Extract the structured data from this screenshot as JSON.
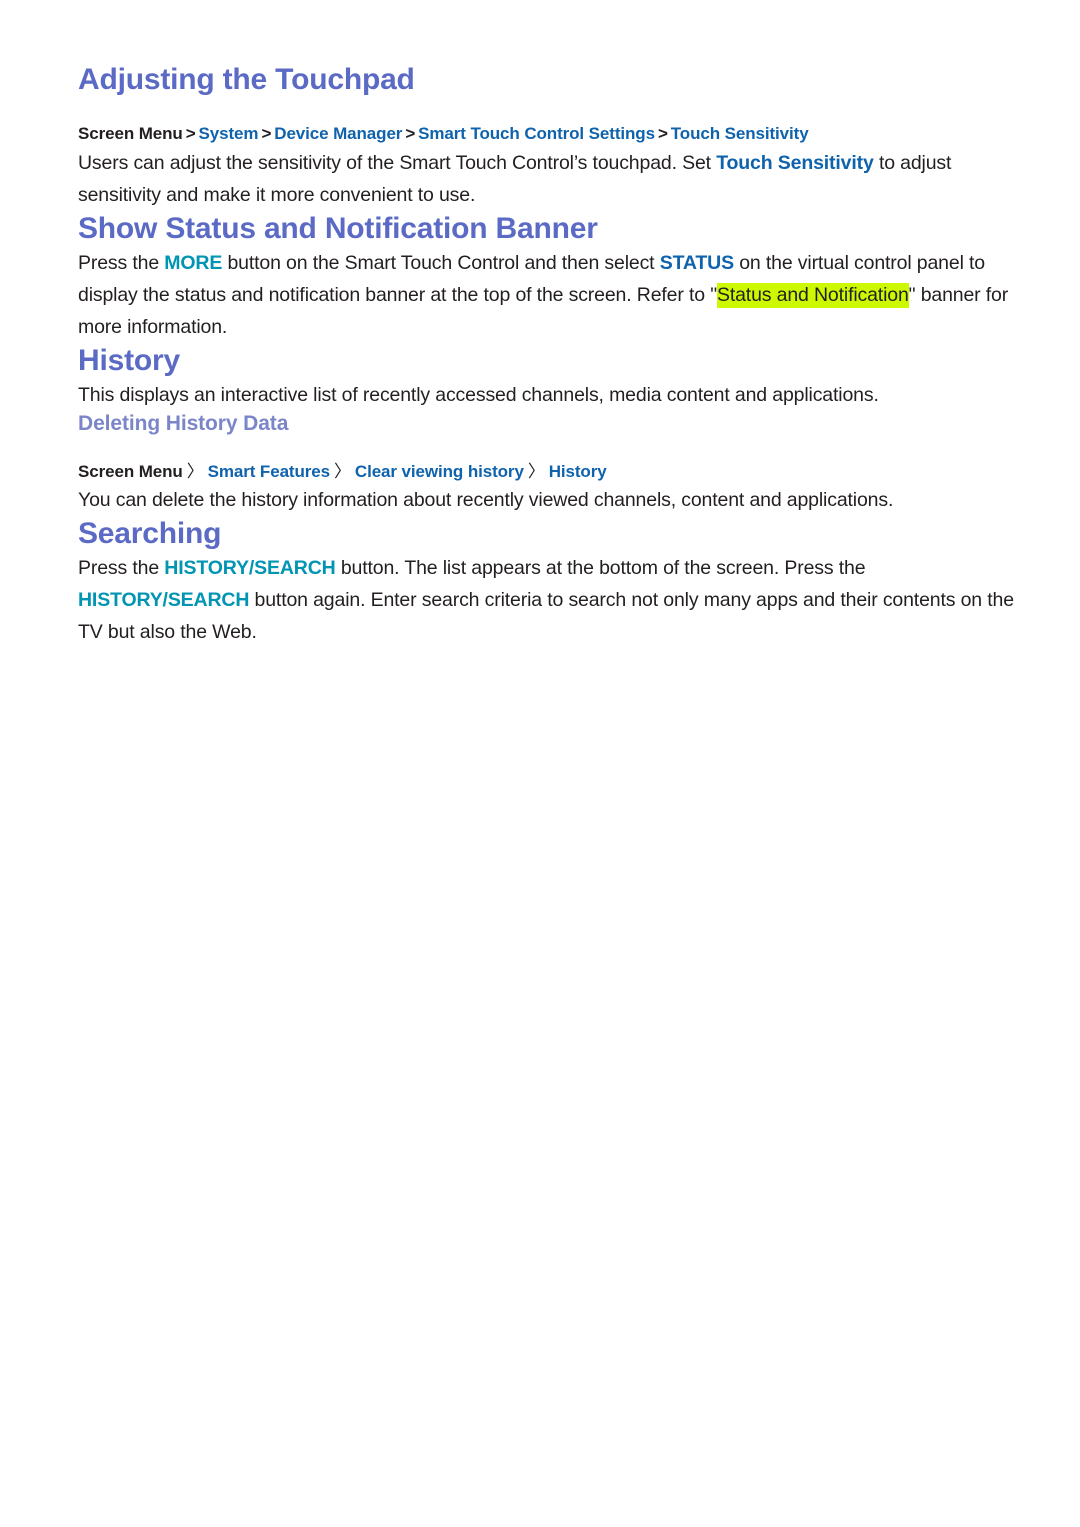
{
  "document": {
    "background_color": "#ffffff",
    "heading_color": "#5b6ac4",
    "subheading_color": "#7b86ca",
    "link_color": "#0f63ad",
    "accent_teal_color": "#0195b4",
    "highlight_color": "#ccf900",
    "body_text_color": "#231f20"
  },
  "sections": {
    "touchpad": {
      "title": "Adjusting the Touchpad",
      "breadcrumb": {
        "root": "Screen Menu",
        "separator": ">",
        "items": [
          "System",
          "Device Manager",
          "Smart Touch Control Settings",
          "Touch Sensitivity"
        ]
      },
      "paragraph": {
        "part1": "Users can adjust the sensitivity of the Smart Touch Control’s touchpad. Set ",
        "link1": "Touch Sensitivity",
        "part2": " to adjust sensitivity and make it more convenient to use."
      }
    },
    "status_banner": {
      "title": "Show Status and Notification Banner",
      "paragraph": {
        "part1": "Press the ",
        "link1": "MORE",
        "part2": " button on the Smart Touch Control and then select ",
        "link2": "STATUS",
        "part3": " on the virtual control panel to display the status and notification banner at the top of the screen. Refer to \"",
        "highlight": "Status and Notification",
        "part4": "\" banner for more information."
      }
    },
    "history": {
      "title": "History",
      "paragraph": "This displays an interactive list of recently accessed channels, media content and applications."
    },
    "deleting_history": {
      "subtitle": "Deleting History Data",
      "breadcrumb": {
        "root": "Screen Menu",
        "separator": "〉",
        "items": [
          "Smart Features",
          "Clear viewing history",
          "History"
        ]
      },
      "paragraph": "You can delete the history information about recently viewed channels, content and applications."
    },
    "searching": {
      "title": "Searching",
      "paragraph": {
        "part1": "Press the ",
        "link1": "HISTORY/SEARCH",
        "part2": " button. The list appears at the bottom of the screen. Press the ",
        "link2": "HISTORY/SEARCH",
        "part3": " button again. Enter search criteria to search not only many apps and their contents on the TV but also the Web."
      }
    }
  }
}
